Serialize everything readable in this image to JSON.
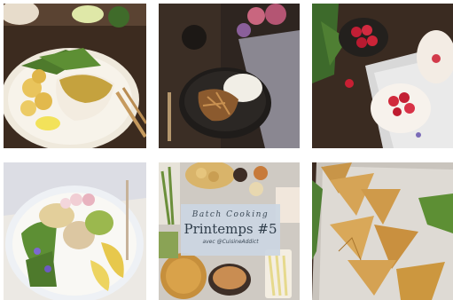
{
  "gallery": {
    "tiles": [
      {
        "subject": "fish-potatoes-plate"
      },
      {
        "subject": "wok-rice-dish"
      },
      {
        "subject": "strawberry-dessert"
      },
      {
        "subject": "buddha-bowl"
      },
      {
        "subject": "batch-cooking-spread",
        "overlay": {
          "line1": "Batch Cooking",
          "line2": "Printemps #5",
          "line3": "avec @CuisineAddict"
        }
      },
      {
        "subject": "samosas-tray"
      }
    ]
  },
  "colors": {
    "wood_dark": "#3a2a1f",
    "wood_mid": "#5a4330",
    "overlay_bg": "#cbd6e2",
    "plate_white": "#f4f1ea",
    "herb_green": "#4e7a2c"
  }
}
